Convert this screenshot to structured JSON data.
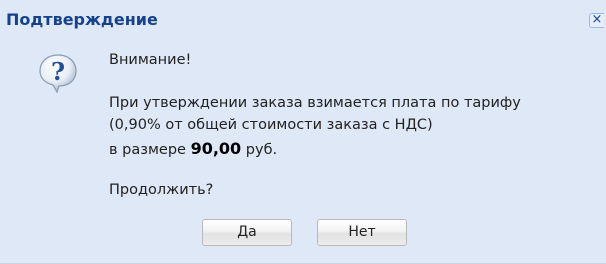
{
  "dialog": {
    "title": "Подтверждение",
    "close_label": "×",
    "icon": "question-icon",
    "heading": "Внимание!",
    "message_line1": "При утверждении заказа взимается плата по тарифу",
    "message_line2": "(0,90% от общей стоимости заказа с НДС)",
    "message_line3_prefix": "в размере ",
    "amount": "90,00",
    "message_line3_suffix": " руб.",
    "question": "Продолжить?",
    "yes_label": "Да",
    "no_label": "Нет"
  },
  "colors": {
    "background": "#dfe8f6",
    "title": "#15428b"
  }
}
